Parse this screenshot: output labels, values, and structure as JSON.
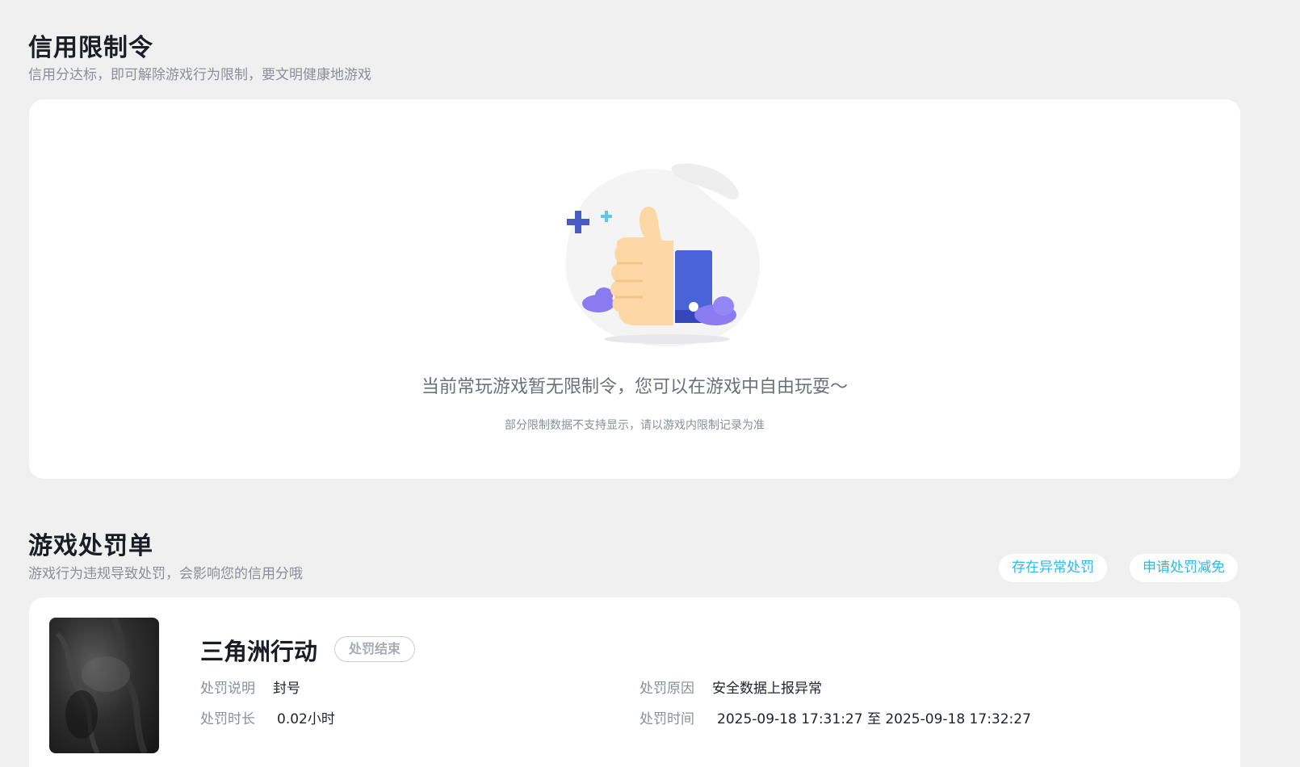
{
  "credit_section": {
    "title": "信用限制令",
    "subtitle": "信用分达标，即可解除游戏行为限制，要文明健康地游戏"
  },
  "empty_state": {
    "illustration_icon": "thumbs-up-icon",
    "message": "当前常玩游戏暂无限制令，您可以在游戏中自由玩耍～",
    "note": "部分限制数据不支持显示，请以游戏内限制记录为准"
  },
  "penalty_section": {
    "title": "游戏处罚单",
    "subtitle": "游戏行为违规导致处罚，会影响您的信用分哦",
    "abnormal_button": "存在异常处罚",
    "appeal_button": "申请处罚减免"
  },
  "penalty_card": {
    "game_name": "三角洲行动",
    "status": "处罚结束",
    "desc_label": "处罚说明",
    "desc_value": "封号",
    "duration_label": "处罚时长",
    "duration_value": "0.02小时",
    "reason_label": "处罚原因",
    "reason_value": "安全数据上报异常",
    "time_label": "处罚时间",
    "time_value": "2025-09-18 17:31:27 至 2025-09-18 17:32:27"
  },
  "colors": {
    "background": "#f0f0f0",
    "card": "#ffffff",
    "accent_link": "#2fb8e8",
    "thumb_blue": "#4a63d8",
    "hand": "#fdd8a4"
  }
}
